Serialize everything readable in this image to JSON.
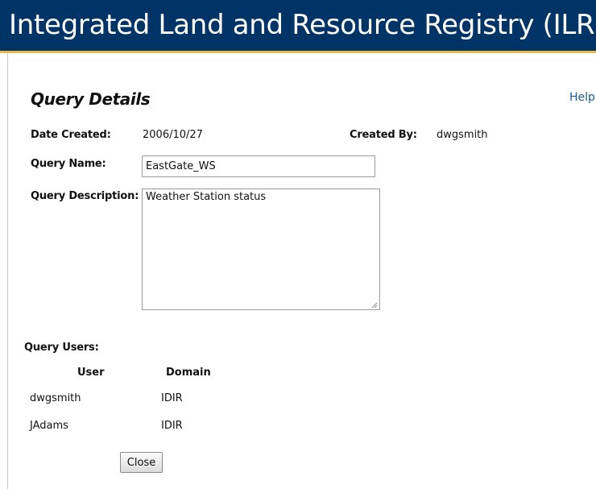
{
  "app": {
    "title": "Integrated Land and Resource Registry (ILRR)"
  },
  "page": {
    "heading": "Query Details",
    "help_label": "Help"
  },
  "details": {
    "date_created_label": "Date Created:",
    "date_created_value": "2006/10/27",
    "created_by_label": "Created By:",
    "created_by_value": "dwgsmith",
    "query_name_label": "Query Name:",
    "query_name_value": "EastGate_WS",
    "query_description_label": "Query Description:",
    "query_description_value": "Weather Station status"
  },
  "users": {
    "section_label": "Query Users:",
    "columns": [
      "User",
      "Domain"
    ],
    "rows": [
      {
        "user": "dwgsmith",
        "domain": "IDIR"
      },
      {
        "user": "JAdams",
        "domain": "IDIR"
      }
    ]
  },
  "actions": {
    "close_label": "Close"
  },
  "colors": {
    "banner": "#003366",
    "banner_accent": "#e8b94a",
    "link": "#1a5a96"
  }
}
